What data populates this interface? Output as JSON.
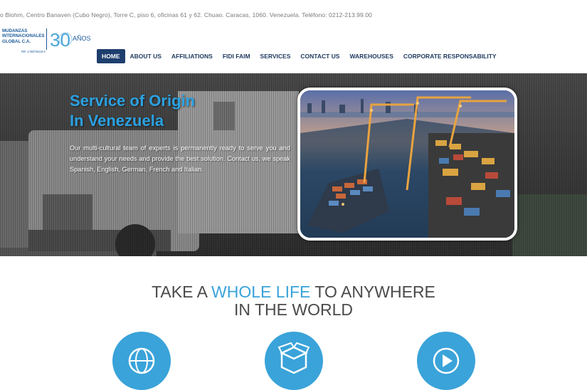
{
  "topbar": {
    "address": "o Blohm, Centro Banaven (Cubo Negro), Torre C, piso 6, oficinas 61 y 62. Chuao. Caracas, 1060. Venezuela. Teléfono: 0212-213.99.00"
  },
  "logo": {
    "line1": "MUDANZAS",
    "line2": "INTERNACIONALES",
    "line3": "GLOBAL C.A.",
    "rif": "RIF J-30375419-4",
    "anniversary_number": "30",
    "anniversary_word": "AÑOS"
  },
  "nav": {
    "items": [
      {
        "label": "HOME",
        "active": true
      },
      {
        "label": "ABOUT US"
      },
      {
        "label": "AFFILIATIONS"
      },
      {
        "label": "FIDI FAIM"
      },
      {
        "label": "SERVICES"
      },
      {
        "label": "CONTACT US"
      },
      {
        "label": "WAREHOUSES"
      },
      {
        "label": "CORPORATE RESPONSABILITY"
      }
    ]
  },
  "hero": {
    "title_line1": "Service of Origin",
    "title_line2": "In Venezuela",
    "body": "Our multi-cultural team of experts is permanently ready to serve you and understand your needs and provide the best solution. Contact us, we speak Spanish, English, German, French and Italian."
  },
  "tagline": {
    "part1": "TAKE A ",
    "highlight": "WHOLE LIFE",
    "part2": " TO ANYWHERE",
    "line2": "IN THE WORLD"
  },
  "features": {
    "icons": [
      "globe-icon",
      "box-icon",
      "clock-icon"
    ]
  },
  "colors": {
    "accent": "#3aa3d9",
    "nav_text": "#1e3a5f",
    "nav_active_bg": "#1e3f6e",
    "hero_title": "#2ba2e2"
  }
}
